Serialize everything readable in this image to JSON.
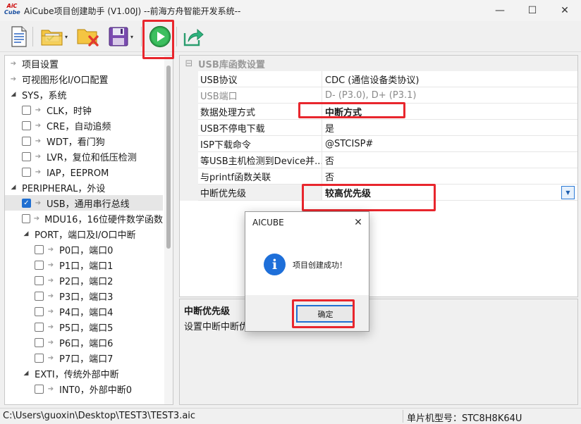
{
  "window": {
    "title": "AiCube项目创建助手 (V1.00J) --前海方舟智能开发系统--",
    "logo_line1": "AiC",
    "logo_line2": "Cube",
    "minimize_glyph": "—",
    "maximize_glyph": "☐",
    "close_glyph": "✕"
  },
  "toolbar": {
    "buttons": [
      "new-document-icon",
      "open-folder-icon",
      "close-project-icon",
      "save-icon",
      "run-generate-icon",
      "export-icon"
    ],
    "dropdown_glyph": "▾",
    "highlight_color": "#e8262d"
  },
  "tree": {
    "items": [
      {
        "label": "项目设置",
        "kind": "arrow"
      },
      {
        "label": "可视图形化I/O口配置",
        "kind": "arrow"
      },
      {
        "label": "SYS，系统",
        "kind": "group"
      },
      {
        "label": "CLK，时钟",
        "kind": "check"
      },
      {
        "label": "CRE，自动追频",
        "kind": "check"
      },
      {
        "label": "WDT，看门狗",
        "kind": "check"
      },
      {
        "label": "LVR，复位和低压检测",
        "kind": "check"
      },
      {
        "label": "IAP，EEPROM",
        "kind": "check"
      },
      {
        "label": "PERIPHERAL，外设",
        "kind": "group"
      },
      {
        "label": "USB，通用串行总线",
        "kind": "check",
        "checked": true
      },
      {
        "label": "MDU16，16位硬件数学函数",
        "kind": "check"
      },
      {
        "label": "PORT，端口及I/O口中断",
        "kind": "group"
      },
      {
        "label": "P0口，端口0",
        "kind": "check"
      },
      {
        "label": "P1口，端口1",
        "kind": "check"
      },
      {
        "label": "P2口，端口2",
        "kind": "check"
      },
      {
        "label": "P3口，端口3",
        "kind": "check"
      },
      {
        "label": "P4口，端口4",
        "kind": "check"
      },
      {
        "label": "P5口，端口5",
        "kind": "check"
      },
      {
        "label": "P6口，端口6",
        "kind": "check"
      },
      {
        "label": "P7口，端口7",
        "kind": "check"
      },
      {
        "label": "EXTI，传统外部中断",
        "kind": "group"
      },
      {
        "label": "INT0，外部中断0",
        "kind": "check"
      }
    ]
  },
  "props": {
    "header": "USB库函数设置",
    "collapse_glyph": "⊟",
    "rows": [
      {
        "name": "USB协议",
        "value": "CDC (通信设备类协议)"
      },
      {
        "name": "USB端口",
        "value": "D- (P3.0), D+ (P3.1)",
        "gray": true
      },
      {
        "name": "数据处理方式",
        "value": "中断方式",
        "bold": true
      },
      {
        "name": "USB不停电下载",
        "value": "是"
      },
      {
        "name": "ISP下载命令",
        "value": "@STCISP#"
      },
      {
        "name": "等USB主机检测到Device并...",
        "value": "否"
      },
      {
        "name": "与printf函数关联",
        "value": "否"
      },
      {
        "name": "中断优先级",
        "value": "较高优先级",
        "bold": true,
        "selected": true
      }
    ]
  },
  "description": {
    "title": "中断优先级",
    "text": "设置中断中断优先级"
  },
  "status": {
    "path": "C:\\Users\\guoxin\\Desktop\\TEST3\\TEST3.aic",
    "model": "单片机型号：STC8H8K64U"
  },
  "dialog": {
    "title": "AICUBE",
    "close_glyph": "✕",
    "info_glyph": "i",
    "message": "项目创建成功！",
    "ok_label": "确定"
  }
}
